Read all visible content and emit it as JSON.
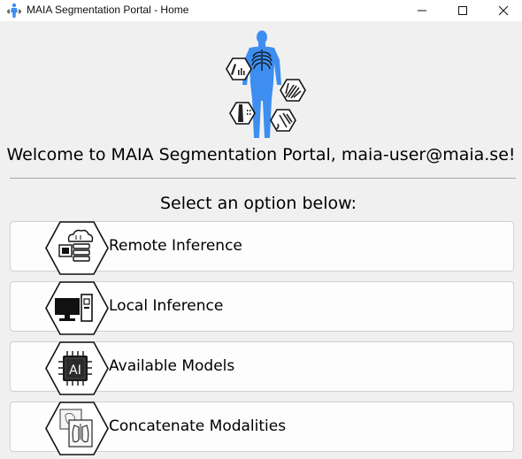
{
  "window": {
    "title": "MAIA Segmentation Portal - Home",
    "minimize_symbol": "—",
    "close_symbol": "✕"
  },
  "header": {
    "logo_icon": "maia-body-anatomy-logo-icon",
    "welcome_text": "Welcome to MAIA Segmentation Portal, maia-user@maia.se!",
    "select_text": "Select an option below:"
  },
  "options": [
    {
      "label": "Remote Inference",
      "icon": "cloud-server-gpu-icon"
    },
    {
      "label": "Local Inference",
      "icon": "desktop-computer-icon"
    },
    {
      "label": "Available Models",
      "icon": "ai-chip-icon"
    },
    {
      "label": "Concatenate Modalities",
      "icon": "stacked-scans-icon"
    }
  ],
  "colors": {
    "background": "#f0f0f0",
    "button_bg": "#fdfdfd",
    "logo_blue": "#3d8ef0",
    "text": "#000000"
  }
}
